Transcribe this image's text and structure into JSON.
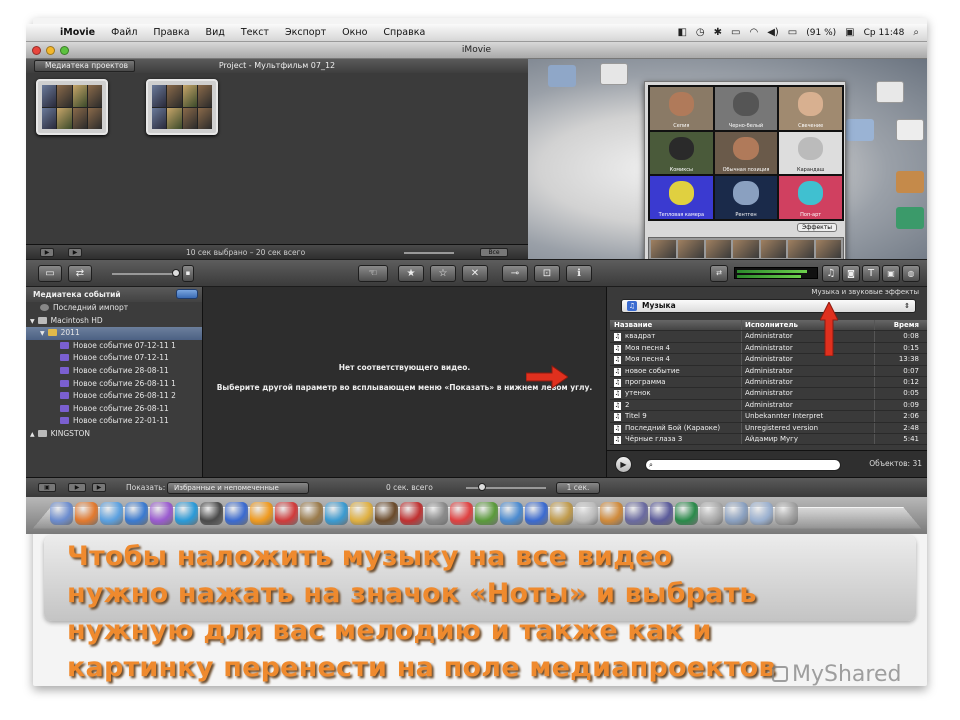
{
  "menubar": {
    "app": "iMovie",
    "items": [
      "Файл",
      "Правка",
      "Вид",
      "Текст",
      "Экспорт",
      "Окно",
      "Справка"
    ],
    "battery": "(91 %)",
    "clock": "Ср 11:48"
  },
  "window": {
    "title": "iMovie"
  },
  "project_library": {
    "back_label": "Медиатека проектов",
    "project_title": "Project - Мультфильм 07_12",
    "status": "10 сек выбрано – 20 сек всего",
    "all_label": "Все"
  },
  "photobooth": {
    "effects": [
      "Сепия",
      "Черно-белый",
      "Свечение",
      "Комиксы",
      "Обычная позиция",
      "Карандаш",
      "Тепловая камера",
      "Рентген",
      "Поп-арт"
    ],
    "effects_button": "Эффекты"
  },
  "event_library": {
    "header": "Медиатека событий",
    "rows": [
      {
        "label": "Последний импорт",
        "icon": "clock-icon",
        "indent": 1
      },
      {
        "label": "Macintosh HD",
        "icon": "disk-icon",
        "indent": 0,
        "disclosure": "▼"
      },
      {
        "label": "2011",
        "icon": "folder-icon",
        "indent": 1,
        "disclosure": "▼",
        "selected": true
      },
      {
        "label": "Новое событие 07-12-11 1",
        "icon": "star-icon",
        "indent": 3
      },
      {
        "label": "Новое событие 07-12-11",
        "icon": "star-icon",
        "indent": 3
      },
      {
        "label": "Новое событие 28-08-11",
        "icon": "star-icon",
        "indent": 3
      },
      {
        "label": "Новое событие 26-08-11 1",
        "icon": "star-icon",
        "indent": 3
      },
      {
        "label": "Новое событие 26-08-11 2",
        "icon": "star-icon",
        "indent": 3
      },
      {
        "label": "Новое событие 26-08-11",
        "icon": "star-icon",
        "indent": 3
      },
      {
        "label": "Новое событие 22-01-11",
        "icon": "star-icon",
        "indent": 3
      },
      {
        "label": "KINGSTON",
        "icon": "disk-icon",
        "indent": 0,
        "disclosure": "▲"
      }
    ]
  },
  "viewer": {
    "message_1": "Нет соответствующего видео.",
    "message_2": "Выберите другой параметр во всплывающем меню «Показать» в нижнем левом углу."
  },
  "music_browser": {
    "header": "Музыка и звуковые эффекты",
    "source": "Музыка",
    "columns": [
      "Название",
      "Исполнитель",
      "Время"
    ],
    "tracks": [
      [
        "квадрат",
        "Administrator",
        "0:08"
      ],
      [
        "Моя песня 4",
        "Administrator",
        "0:15"
      ],
      [
        "Моя песня 4",
        "Administrator",
        "13:38"
      ],
      [
        "новое событие",
        "Administrator",
        "0:07"
      ],
      [
        "программа",
        "Administrator",
        "0:12"
      ],
      [
        "утенок",
        "Administrator",
        "0:05"
      ],
      [
        "2",
        "Administrator",
        "0:09"
      ],
      [
        "Titel 9",
        "Unbekannter Interpret",
        "2:06"
      ],
      [
        "Последний Бой (Караоке)",
        "Unregistered version",
        "2:48"
      ],
      [
        "Чёрные глаза 3",
        "Айдамир Мугу",
        "5:41"
      ]
    ],
    "count_label": "Объектов: 31"
  },
  "bottom_bar": {
    "show_label": "Показать:",
    "show_value": "Избранные и непомеченные",
    "total": "0 сек. всего",
    "zoom": "1 сек."
  },
  "caption": {
    "lines": [
      "Чтобы  наложить музыку на все видео",
      "нужно нажать на значок «Ноты» и выбрать",
      "нужную для вас мелодию и также как и",
      "картинку перенести на поле медиапроектов"
    ],
    "color": "#ef8a2e"
  },
  "watermark": "MyShared",
  "annotation_color": "#e0301e"
}
